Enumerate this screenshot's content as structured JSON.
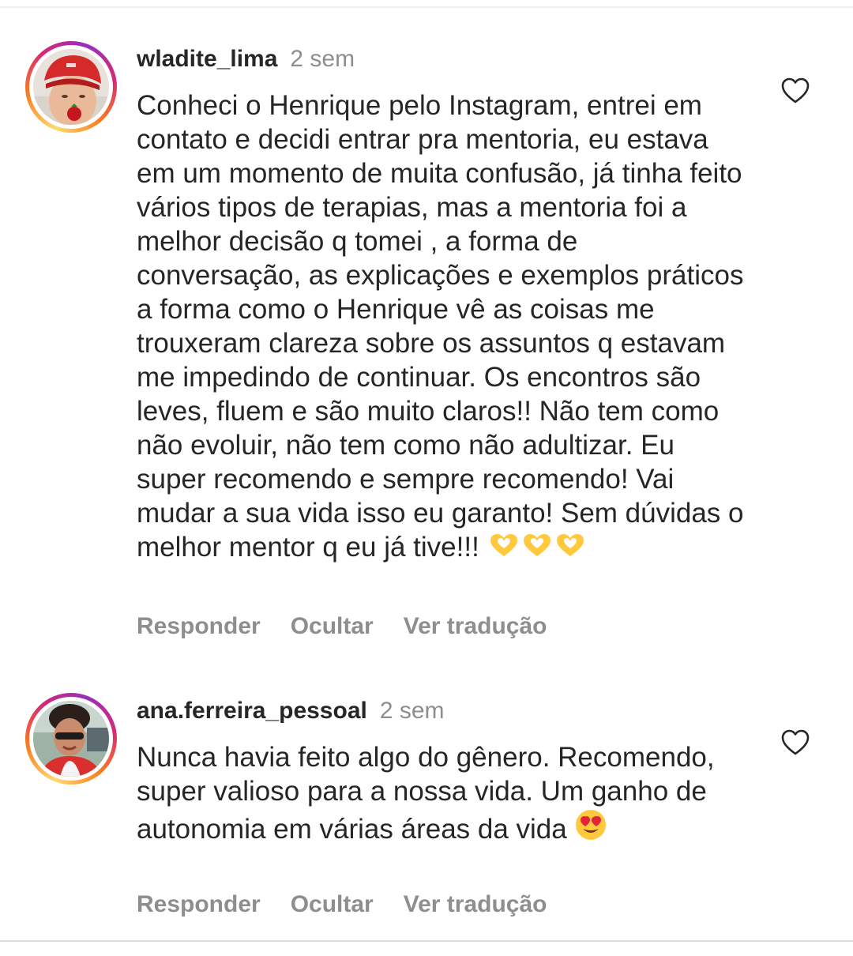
{
  "comments": [
    {
      "username": "wladite_lima",
      "time": "2 sem",
      "text": "Conheci o Henrique pelo Instagram, entrei em contato e decidi entrar pra mentoria, eu estava em um momento de muita confusão, já tinha feito vários tipos de terapias, mas a mentoria foi a melhor decisão q tomei , a forma de conversação, as explicações e exemplos práticos a forma como o Henrique vê as coisas me trouxeram clareza sobre os assuntos q estavam me impedindo de continuar.  Os encontros são leves, fluem e são muito claros!! Não tem como não evoluir, não tem como não adultizar. Eu super recomendo e sempre recomendo! Vai mudar a sua vida isso eu garanto! Sem dúvidas o melhor mentor q eu já tive!!!",
      "trailing_emoji": "heart-hands-emoji",
      "trailing_emoji_count": 3,
      "actions": {
        "reply": "Responder",
        "hide": "Ocultar",
        "translate": "Ver tradução"
      },
      "like_icon": "heart-outline-icon"
    },
    {
      "username": "ana.ferreira_pessoal",
      "time": "2 sem",
      "text": "Nunca havia feito algo do gênero. Recomendo, super valioso para a nossa vida. Um ganho de autonomia em várias áreas da vida",
      "trailing_emoji": "heart-eyes-emoji",
      "trailing_emoji_count": 1,
      "actions": {
        "reply": "Responder",
        "hide": "Ocultar",
        "translate": "Ver tradução"
      },
      "like_icon": "heart-outline-icon"
    }
  ],
  "colors": {
    "text": "#262626",
    "secondary": "#8e8e8e",
    "divider": "#dbdbdb",
    "story_ring": [
      "#feda75",
      "#fa7e1e",
      "#d62976",
      "#962fbf"
    ],
    "emoji_yellow": "#ffc83d"
  }
}
